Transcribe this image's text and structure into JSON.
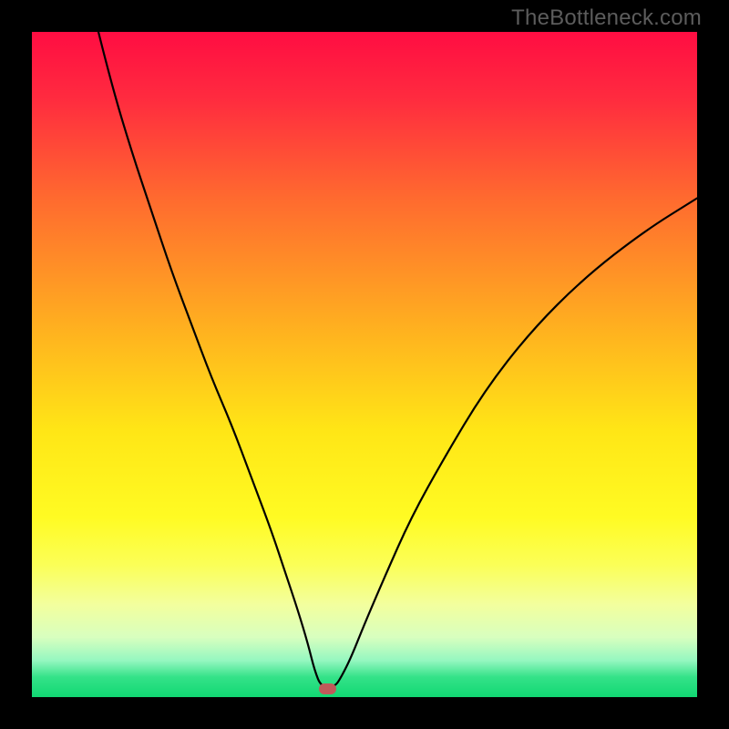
{
  "watermark": "TheBottleneck.com",
  "chart_data": {
    "type": "line",
    "title": "",
    "xlabel": "",
    "ylabel": "",
    "xlim": [
      0,
      100
    ],
    "ylim": [
      0,
      100
    ],
    "grid": false,
    "legend": false,
    "background_gradient_stops": [
      {
        "pos": 0.0,
        "color": "#ff0d42"
      },
      {
        "pos": 0.1,
        "color": "#ff2b3f"
      },
      {
        "pos": 0.25,
        "color": "#ff6a2f"
      },
      {
        "pos": 0.45,
        "color": "#ffb21f"
      },
      {
        "pos": 0.6,
        "color": "#ffe616"
      },
      {
        "pos": 0.73,
        "color": "#fffb23"
      },
      {
        "pos": 0.8,
        "color": "#fbff56"
      },
      {
        "pos": 0.86,
        "color": "#f3ff9d"
      },
      {
        "pos": 0.91,
        "color": "#d8ffbf"
      },
      {
        "pos": 0.945,
        "color": "#95f7c0"
      },
      {
        "pos": 0.97,
        "color": "#34e288"
      },
      {
        "pos": 1.0,
        "color": "#11d873"
      }
    ],
    "series": [
      {
        "name": "bottleneck-curve",
        "color": "#000000",
        "x": [
          10,
          12,
          15,
          18,
          21,
          24,
          27,
          30,
          33,
          36,
          38,
          40,
          41.5,
          42.5,
          43.5,
          45.5,
          46.5,
          48,
          50,
          53,
          57,
          62,
          68,
          75,
          83,
          92,
          100
        ],
        "y": [
          100,
          92,
          82,
          73,
          64,
          56,
          48,
          41,
          33,
          25,
          19,
          13,
          8,
          4,
          1.5,
          1.5,
          3,
          6,
          11,
          18,
          27,
          36,
          46,
          55,
          63,
          70,
          75
        ]
      }
    ],
    "marker": {
      "name": "optimal-point",
      "x": 44.5,
      "y": 1.2,
      "w": 2.6,
      "h": 1.6,
      "color": "#c05a5a"
    }
  }
}
